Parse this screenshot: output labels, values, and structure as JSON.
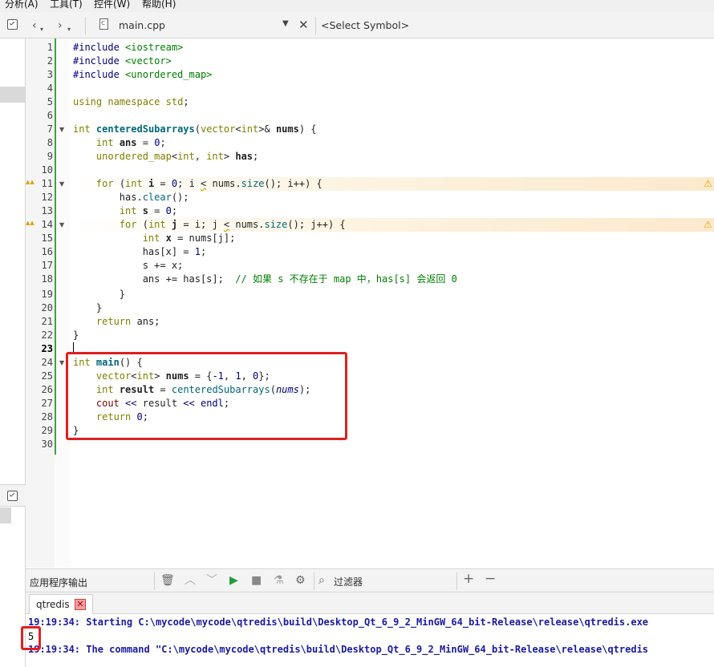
{
  "menu": [
    "分析(A)",
    "工具(T)",
    "控件(W)",
    "帮助(H)"
  ],
  "editor_toolbar": {
    "back_icon": "back-chevron-icon",
    "file_name": "main.cpp",
    "symbol_placeholder": "<Select Symbol>"
  },
  "code_lines": [
    {
      "n": "1"
    },
    {
      "n": "2"
    },
    {
      "n": "3"
    },
    {
      "n": "4"
    },
    {
      "n": "5"
    },
    {
      "n": "6"
    },
    {
      "n": "7"
    },
    {
      "n": "8"
    },
    {
      "n": "9"
    },
    {
      "n": "10"
    },
    {
      "n": "11"
    },
    {
      "n": "12"
    },
    {
      "n": "13"
    },
    {
      "n": "14"
    },
    {
      "n": "15"
    },
    {
      "n": "16"
    },
    {
      "n": "17"
    },
    {
      "n": "18"
    },
    {
      "n": "19"
    },
    {
      "n": "20"
    },
    {
      "n": "21"
    },
    {
      "n": "22"
    },
    {
      "n": "23"
    },
    {
      "n": "24"
    },
    {
      "n": "25"
    },
    {
      "n": "26"
    },
    {
      "n": "27"
    },
    {
      "n": "28"
    },
    {
      "n": "29"
    },
    {
      "n": "30"
    }
  ],
  "code": {
    "l1": [
      "#include ",
      "<iostream>"
    ],
    "l2": [
      "#include ",
      "<vector>"
    ],
    "l3": [
      "#include ",
      "<unordered_map>"
    ],
    "l5": [
      "using",
      " ",
      "namespace",
      " ",
      "std",
      ";"
    ],
    "l7": [
      "int",
      " ",
      "centeredSubarrays",
      "(",
      "vector",
      "<",
      "int",
      ">& ",
      "nums",
      ") {"
    ],
    "l8": [
      "    ",
      "int",
      " ",
      "ans",
      " = ",
      "0",
      ";"
    ],
    "l9": [
      "    ",
      "unordered_map",
      "<",
      "int",
      ", ",
      "int",
      "> ",
      "has",
      ";"
    ],
    "l11": [
      "    ",
      "for",
      " (",
      "int",
      " ",
      "i",
      " = ",
      "0",
      "; i ",
      "<",
      " nums.",
      "size",
      "(); i++) {"
    ],
    "l12": [
      "        ",
      "has.",
      "clear",
      "();"
    ],
    "l13": [
      "        ",
      "int",
      " ",
      "s",
      " = ",
      "0",
      ";"
    ],
    "l14": [
      "        ",
      "for",
      " (",
      "int",
      " ",
      "j",
      " = i; j ",
      "<",
      " nums.",
      "size",
      "(); j++) {"
    ],
    "l15": [
      "            ",
      "int",
      " ",
      "x",
      " = nums[j];"
    ],
    "l16": [
      "            ",
      "has[x] = ",
      "1",
      ";"
    ],
    "l17": [
      "            ",
      "s += x;"
    ],
    "l18": [
      "            ",
      "ans += has[s];  ",
      "// 如果 s 不存在于 map 中，has[s] 会返回 0"
    ],
    "l19": [
      "        ",
      "}"
    ],
    "l20": [
      "    ",
      "}"
    ],
    "l21": [
      "    ",
      "return",
      " ans;"
    ],
    "l22": [
      "}"
    ],
    "l24": [
      "int",
      " ",
      "main",
      "() {"
    ],
    "l25": [
      "    ",
      "vector",
      "<",
      "int",
      "> ",
      "nums",
      " = {",
      "-1",
      ", ",
      "1",
      ", ",
      "0",
      "};"
    ],
    "l26": [
      "    ",
      "int",
      " ",
      "result",
      " = ",
      "centeredSubarrays",
      "(",
      "nums",
      ");"
    ],
    "l27": [
      "    ",
      "cout",
      " ",
      "<<",
      " result ",
      "<<",
      " ",
      "endl",
      ";"
    ],
    "l28": [
      "    ",
      "return",
      " ",
      "0",
      ";"
    ],
    "l29": [
      "}"
    ]
  },
  "output": {
    "title": "应用程序输出",
    "filter_label": "过滤器",
    "tab": "qtredis",
    "lines": [
      "19:19:34: Starting C:\\mycode\\mycode\\qtredis\\build\\Desktop_Qt_6_9_2_MinGW_64_bit-Release\\release\\qtredis.exe",
      "5",
      "19:19:34: The command \"C:\\mycode\\mycode\\qtredis\\build\\Desktop_Qt_6_9_2_MinGW_64_bit-Release\\release\\qtredis"
    ]
  },
  "colors": {
    "highlight": "#e02020",
    "keyword": "#808000",
    "function": "#00677c",
    "comment": "#008000",
    "number": "#000080",
    "output_info": "#1a1aa6"
  }
}
